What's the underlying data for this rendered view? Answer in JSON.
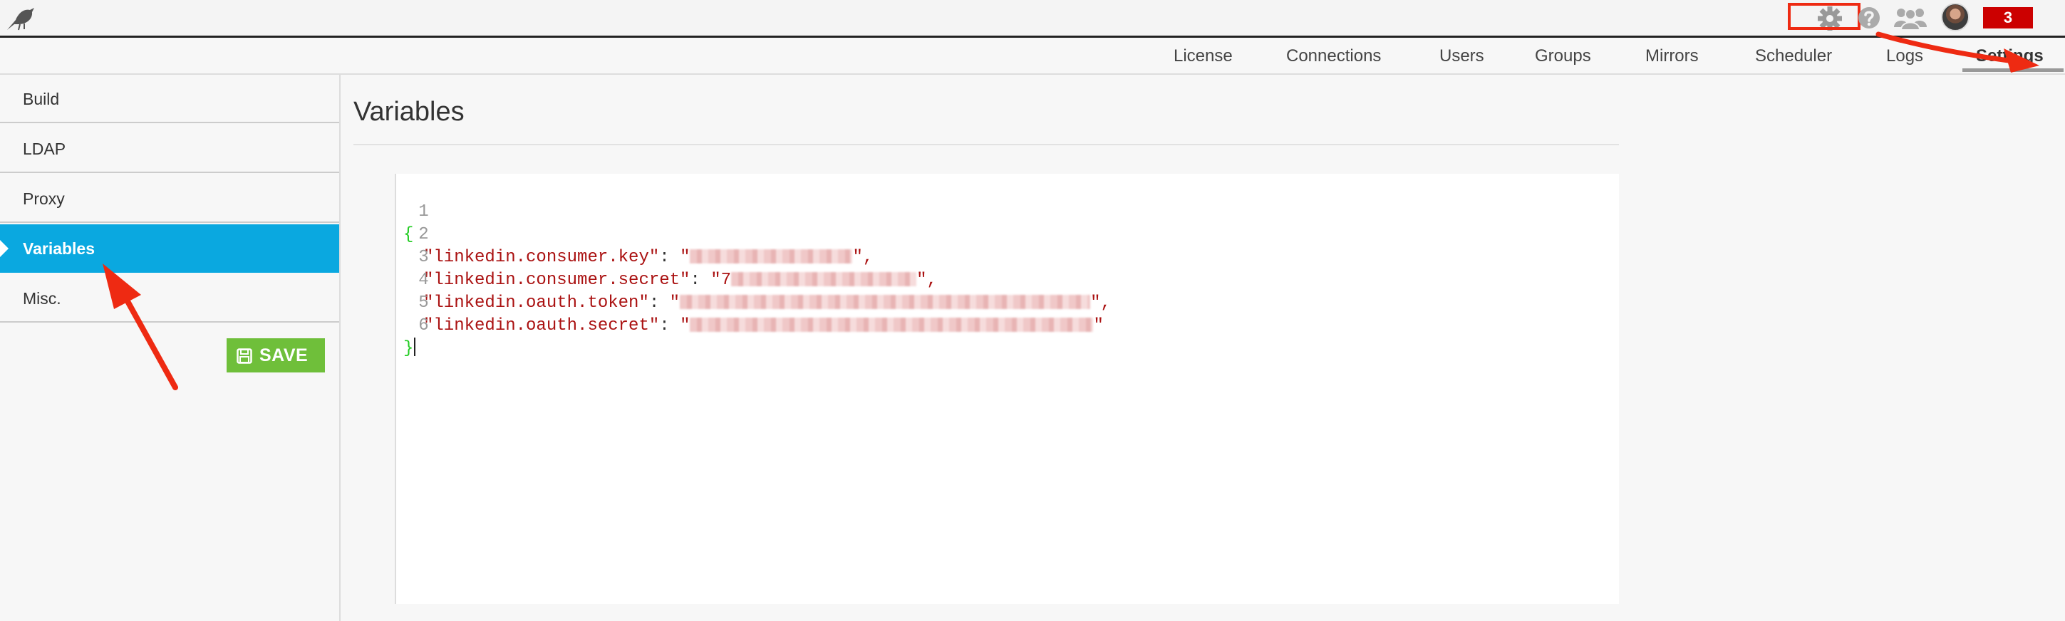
{
  "topbar": {
    "notifications_count": "3",
    "icons": [
      "bird-logo-icon",
      "gear-icon",
      "help-icon",
      "users-icon",
      "avatar"
    ],
    "accent_colors": {
      "notification": "#cc0000",
      "highlight": "#ee2a12"
    }
  },
  "tabs": [
    {
      "label": "License"
    },
    {
      "label": "Connections"
    },
    {
      "label": "Users"
    },
    {
      "label": "Groups"
    },
    {
      "label": "Mirrors"
    },
    {
      "label": "Scheduler"
    },
    {
      "label": "Logs"
    },
    {
      "label": "Settings",
      "active": true
    }
  ],
  "sidebar": {
    "items": [
      {
        "label": "Build"
      },
      {
        "label": "LDAP"
      },
      {
        "label": "Proxy"
      },
      {
        "label": "Variables",
        "active": true
      },
      {
        "label": "Misc."
      }
    ],
    "save_label": "SAVE",
    "active_color": "#0aa8e0",
    "save_color": "#6fbf3a"
  },
  "main": {
    "title": "Variables",
    "editor": {
      "line_numbers": [
        "1",
        "2",
        "3",
        "4",
        "5",
        "6"
      ],
      "open_brace": "{",
      "close_brace": "}",
      "entries": [
        {
          "key": "\"linkedin.consumer.key\"",
          "value_prefix": "\"",
          "value_suffix": "\","
        },
        {
          "key": "\"linkedin.consumer.secret\"",
          "value_prefix": "\"7",
          "value_suffix": "\","
        },
        {
          "key": "\"linkedin.oauth.token\"",
          "value_prefix": "\"",
          "value_suffix": "\","
        },
        {
          "key": "\"linkedin.oauth.secret\"",
          "value_prefix": "\"",
          "value_suffix": "\""
        }
      ]
    }
  }
}
